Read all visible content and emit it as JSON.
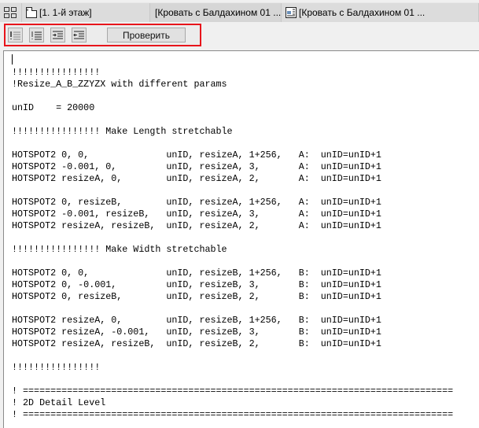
{
  "tabs": [
    {
      "label": "[1. 1-й этаж]",
      "icon": "floor-plan-icon"
    },
    {
      "label": "[Кровать с Балдахином 01 ...",
      "icon": "object-icon"
    },
    {
      "label": "[Кровать с Балдахином 01 ...",
      "icon": "object-params-icon"
    }
  ],
  "toolbar": {
    "buttons": [
      "comment-icon",
      "uncomment-icon",
      "indent-icon",
      "outdent-icon"
    ],
    "check_label": "Проверить"
  },
  "editor": {
    "lines": [
      "!!!!!!!!!!!!!!!!",
      "!Resize_A_B_ZZYZX with different params",
      "",
      "unID    = 20000",
      "",
      "!!!!!!!!!!!!!!!! Make Length stretchable",
      "",
      "HOTSPOT2 0, 0,              unID, resizeA, 1+256,   A:  unID=unID+1",
      "HOTSPOT2 -0.001, 0,         unID, resizeA, 3,       A:  unID=unID+1",
      "HOTSPOT2 resizeA, 0,        unID, resizeA, 2,       A:  unID=unID+1",
      "",
      "HOTSPOT2 0, resizeB,        unID, resizeA, 1+256,   A:  unID=unID+1",
      "HOTSPOT2 -0.001, resizeB,   unID, resizeA, 3,       A:  unID=unID+1",
      "HOTSPOT2 resizeA, resizeB,  unID, resizeA, 2,       A:  unID=unID+1",
      "",
      "!!!!!!!!!!!!!!!! Make Width stretchable",
      "",
      "HOTSPOT2 0, 0,              unID, resizeB, 1+256,   B:  unID=unID+1",
      "HOTSPOT2 0, -0.001,         unID, resizeB, 3,       B:  unID=unID+1",
      "HOTSPOT2 0, resizeB,        unID, resizeB, 2,       B:  unID=unID+1",
      "",
      "HOTSPOT2 resizeA, 0,        unID, resizeB, 1+256,   B:  unID=unID+1",
      "HOTSPOT2 resizeA, -0.001,   unID, resizeB, 3,       B:  unID=unID+1",
      "HOTSPOT2 resizeA, resizeB,  unID, resizeB, 2,       B:  unID=unID+1",
      "",
      "!!!!!!!!!!!!!!!!",
      "",
      "! ==============================================================================",
      "! 2D Detail Level",
      "! =============================================================================="
    ]
  }
}
